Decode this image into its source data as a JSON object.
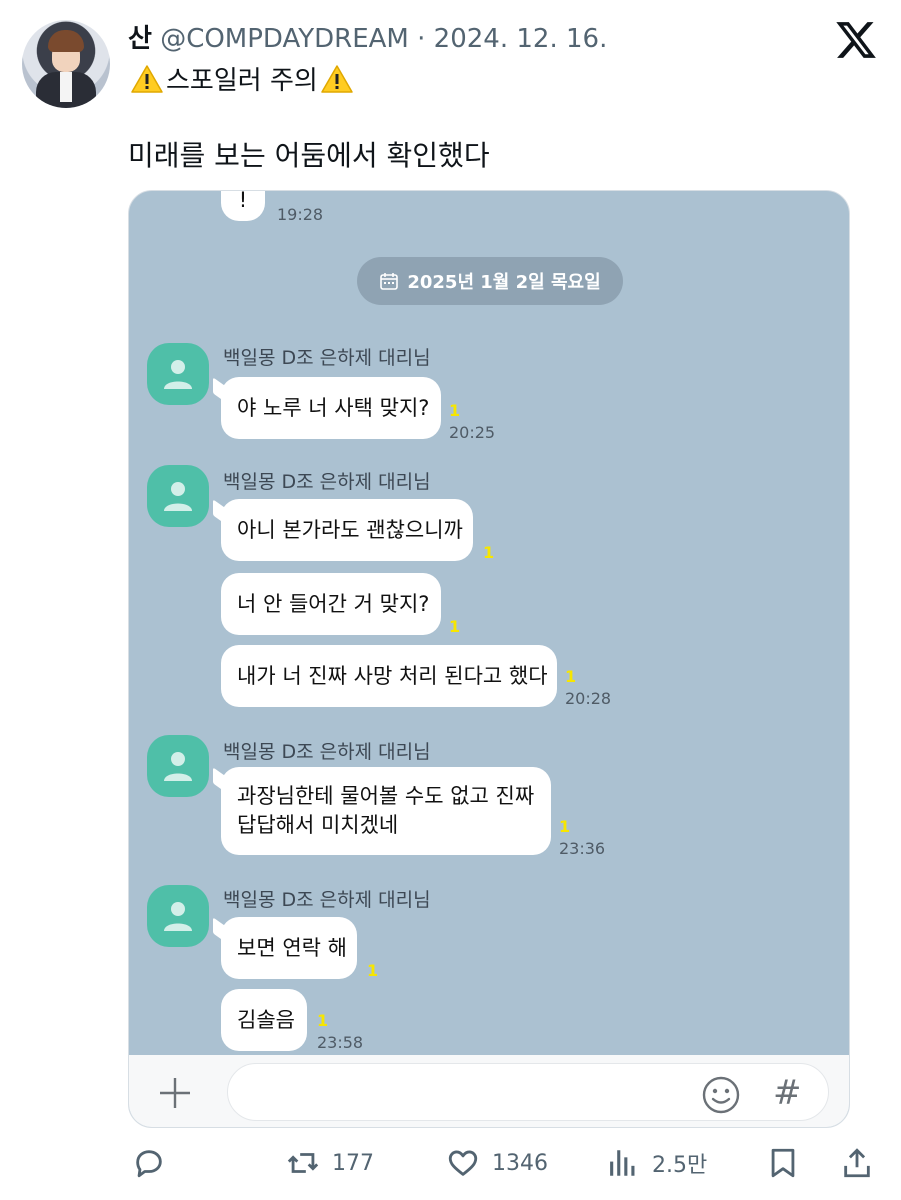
{
  "tweet": {
    "author_name": "산",
    "handle": "@COMPDAYDREAM",
    "separator": "·",
    "date": "2024. 12. 16.",
    "subtitle_text": "스포일러 주의",
    "body": "미래를 보는 어둠에서 확인했다"
  },
  "chat": {
    "top_fragment": "!",
    "top_time": "19:28",
    "date_pill": "2025년 1월 2일 목요일",
    "groups": [
      {
        "sender": "백일몽 D조 은하제 대리님",
        "messages": [
          {
            "text": "야 노루 너 사택 맞지?",
            "read": "1",
            "time": "20:25"
          }
        ]
      },
      {
        "sender": "백일몽 D조 은하제 대리님",
        "messages": [
          {
            "text": "아니 본가라도 괜찮으니까",
            "read": "1",
            "time": ""
          },
          {
            "text": "너 안 들어간 거 맞지?",
            "read": "1",
            "time": ""
          },
          {
            "text": "내가 너 진짜 사망 처리 된다고 했다",
            "read": "1",
            "time": "20:28"
          }
        ]
      },
      {
        "sender": "백일몽 D조 은하제 대리님",
        "messages": [
          {
            "line1": "과장님한테 물어볼 수도 없고 진짜",
            "line2": "답답해서 미치겠네",
            "read": "1",
            "time": "23:36"
          }
        ]
      },
      {
        "sender": "백일몽 D조 은하제 대리님",
        "messages": [
          {
            "text": "보면 연락 해",
            "read": "1",
            "time": ""
          },
          {
            "text": "김솔음",
            "read": "1",
            "time": "23:58"
          }
        ]
      }
    ],
    "input_icons": [
      "plus-icon",
      "emoji-icon",
      "hash-icon"
    ],
    "hash_symbol": "#"
  },
  "actions": {
    "reply": {
      "icon": "reply-icon",
      "count": ""
    },
    "retweet": {
      "icon": "retweet-icon",
      "count": "177"
    },
    "like": {
      "icon": "heart-icon",
      "count": "1346"
    },
    "views": {
      "icon": "views-icon",
      "count": "2.5만"
    },
    "bookmark": {
      "icon": "bookmark-icon"
    },
    "share": {
      "icon": "share-icon"
    }
  },
  "colors": {
    "chat_background": "#abc1d1",
    "profile_avatar": "#4fbfa8",
    "read_marker": "#f7e600",
    "date_pill": "#8fa3b3"
  }
}
